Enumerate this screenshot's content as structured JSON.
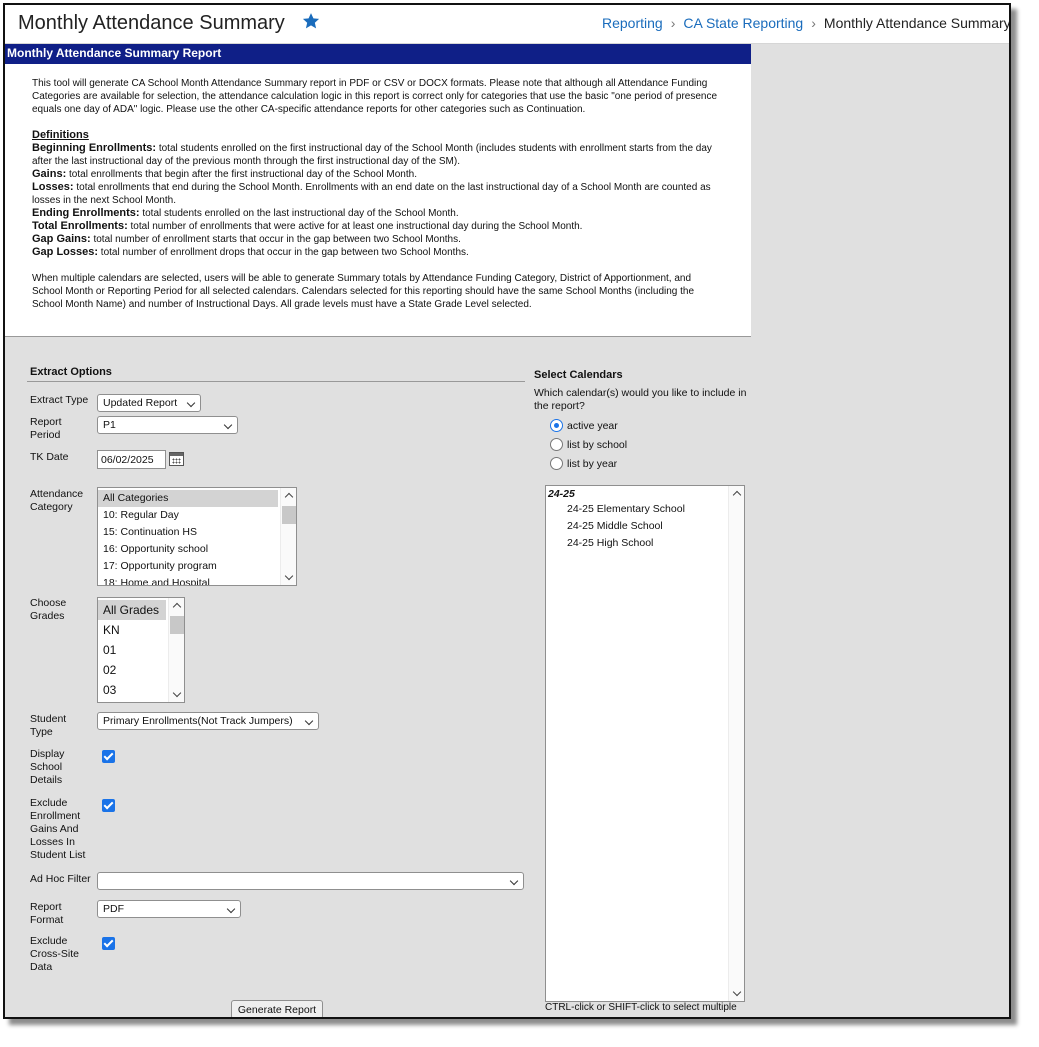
{
  "header": {
    "title": "Monthly Attendance Summary",
    "breadcrumb": [
      "Reporting",
      "CA State Reporting",
      "Monthly Attendance Summary"
    ]
  },
  "panel": {
    "title": "Monthly Attendance Summary Report",
    "intro": "This tool will generate CA School Month Attendance Summary report in PDF or CSV or DOCX formats. Please note that although all Attendance Funding Categories are available for selection, the attendance calculation logic in this report is correct only for categories that use the basic \"one period of presence equals one day of ADA\" logic. Please use the other CA-specific attendance reports for other categories such as Continuation.",
    "definitions_title": "Definitions",
    "definitions": [
      {
        "term": "Beginning Enrollments:",
        "text": " total students enrolled on the first instructional day of the School Month (includes students with enrollment starts from the day after the last instructional day of the previous month through the first instructional day of the SM)."
      },
      {
        "term": "Gains:",
        "text": " total enrollments that begin after the first instructional day of the School Month."
      },
      {
        "term": "Losses:",
        "text": " total enrollments that end during the School Month. Enrollments with an end date on the last instructional day of a School Month are counted as losses in the next School Month."
      },
      {
        "term": "Ending Enrollments:",
        "text": " total students enrolled on the last instructional day of the School Month."
      },
      {
        "term": "Total Enrollments:",
        "text": " total number of enrollments that were active for at least one instructional day during the School Month."
      },
      {
        "term": "Gap Gains:",
        "text": " total number of enrollment starts that occur in the gap between two School Months."
      },
      {
        "term": "Gap Losses:",
        "text": " total number of enrollment drops that occur in the gap between two School Months."
      }
    ],
    "multi_note": "When multiple calendars are selected, users will be able to generate Summary totals by Attendance Funding Category, District of Apportionment, and School Month or Reporting Period for all selected calendars. Calendars selected for this reporting should have the same School Months (including the School Month Name) and number of Instructional Days. All grade levels must have a State Grade Level selected."
  },
  "extract": {
    "section_title": "Extract Options",
    "extract_type": {
      "label": "Extract Type",
      "value": "Updated Report"
    },
    "report_period": {
      "label": "Report Period",
      "value": "P1"
    },
    "tk_date": {
      "label": "TK Date",
      "value": "06/02/2025"
    },
    "attendance_category": {
      "label": "Attendance Category",
      "options": [
        "All Categories",
        "10: Regular Day",
        "15: Continuation HS",
        "16: Opportunity school",
        "17: Opportunity program",
        "18: Home and Hospital"
      ]
    },
    "grades": {
      "label": "Choose Grades",
      "options": [
        "All Grades",
        "KN",
        "01",
        "02",
        "03"
      ]
    },
    "student_type": {
      "label": "Student Type",
      "value": "Primary Enrollments(Not Track Jumpers)"
    },
    "display_school_details": {
      "label": "Display School Details",
      "checked": true
    },
    "exclude_gains_losses": {
      "label": "Exclude Enrollment Gains And Losses In Student List",
      "checked": true
    },
    "ad_hoc_filter": {
      "label": "Ad Hoc Filter",
      "value": ""
    },
    "report_format": {
      "label": "Report Format",
      "value": "PDF"
    },
    "exclude_cross_site": {
      "label": "Exclude Cross-Site Data",
      "checked": true
    },
    "generate_button": "Generate Report"
  },
  "calendars": {
    "section_title": "Select Calendars",
    "question": "Which calendar(s) would you like to include in the report?",
    "radios": [
      {
        "label": "active year",
        "checked": true
      },
      {
        "label": "list by school",
        "checked": false
      },
      {
        "label": "list by year",
        "checked": false
      }
    ],
    "group": "24-25",
    "items": [
      "24-25 Elementary School",
      "24-25 Middle School",
      "24-25 High School"
    ],
    "hint": "CTRL-click or SHIFT-click to select multiple"
  },
  "colors": {
    "header_bar": "#0f1f87",
    "link": "#1a6cbc",
    "accent": "#1a73e8"
  }
}
